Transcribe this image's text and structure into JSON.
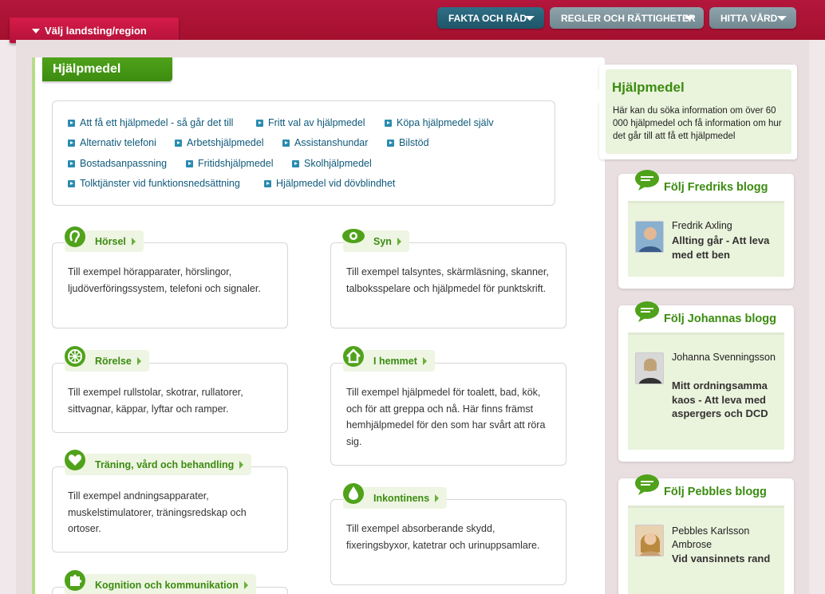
{
  "header": {
    "region_button": "Välj landsting/region",
    "nav": [
      {
        "label": "FAKTA OCH RÅD"
      },
      {
        "label": "REGLER OCH RÄTTIGHETER"
      },
      {
        "label": "HITTA VÅRD"
      }
    ]
  },
  "page": {
    "title": "Hjälpmedel",
    "links": [
      "Att få ett hjälpmedel - så går det till",
      "Fritt val av hjälpmedel",
      "Köpa hjälpmedel själv",
      "Alternativ telefoni",
      "Arbetshjälpmedel",
      "Assistanshundar",
      "Bilstöd",
      "Bostadsanpassning",
      "Fritidshjälpmedel",
      "Skolhjälpmedel",
      "Tolktjänster vid funktionsnedsättning",
      "Hjälpmedel vid dövblindhet"
    ],
    "categories": [
      {
        "title": "Hörsel",
        "icon": "ear-icon",
        "text": "Till exempel hörapparater, hörslingor, ljudöverföringssystem, telefoni och signaler."
      },
      {
        "title": "Syn",
        "icon": "eye-icon",
        "text": "Till exempel talsyntes, skärmläsning, skanner, talboksspelare och hjälpmedel för punktskrift."
      },
      {
        "title": "Rörelse",
        "icon": "wheel-icon",
        "text": "Till exempel rullstolar, skotrar, rullatorer, sittvagnar, käppar, lyftar och ramper."
      },
      {
        "title": "I hemmet",
        "icon": "house-icon",
        "text": "Till exempel hjälpmedel för toalett, bad, kök, och för att greppa och nå. Här finns främst hemhjälpmedel för den som har svårt att röra sig."
      },
      {
        "title": "Träning, vård och behandling",
        "icon": "heart-pulse-icon",
        "text": "Till exempel andningsapparater, muskelstimulatorer, träningsredskap och ortoser."
      },
      {
        "title": "Inkontinens",
        "icon": "drop-icon",
        "text": "Till exempel absorberande skydd, fixeringsbyxor, katetrar och urinuppsamlare."
      },
      {
        "title": "Kognition och kommunikation",
        "icon": "puzzle-icon",
        "text": ""
      }
    ]
  },
  "sidebar": {
    "info": {
      "title": "Hjälpmedel",
      "text": "Här kan du söka information om över 60 000 hjälpmedel och få information om hur det går till att få ett hjälpmedel"
    },
    "blogs": [
      {
        "header": "Följ Fredriks blogg",
        "author": "Fredrik Axling",
        "title": "Allting går - Att leva med ett ben"
      },
      {
        "header": "Följ Johannas blogg",
        "author": "Johanna Svenningsson",
        "title": "Mitt ordningsamma kaos - Att leva med aspergers och DCD"
      },
      {
        "header": "Följ Pebbles blogg",
        "author": "Pebbles Karlsson Ambrose",
        "title": "Vid vansinnets rand"
      }
    ]
  },
  "colors": {
    "brand_red": "#b4163c",
    "green": "#3b8c10",
    "nav_dark": "#1e5568",
    "link_blue": "#0f5a7a"
  }
}
